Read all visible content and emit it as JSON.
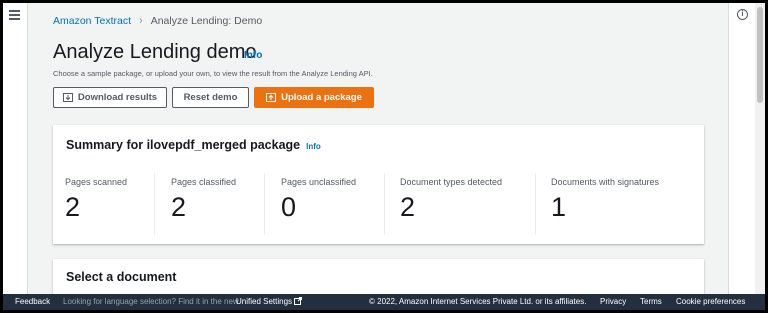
{
  "breadcrumb": {
    "root": "Amazon Textract",
    "current": "Analyze Lending: Demo"
  },
  "page": {
    "title": "Analyze Lending demo",
    "info_label": "Info",
    "description": "Choose a sample package, or upload your own, to view the result from the Analyze Lending API."
  },
  "actions": {
    "download": "Download results",
    "reset": "Reset demo",
    "upload": "Upload a package"
  },
  "summary": {
    "title": "Summary for ilovepdf_merged package",
    "info_label": "Info",
    "metrics": [
      {
        "label": "Pages scanned",
        "value": "2"
      },
      {
        "label": "Pages classified",
        "value": "2"
      },
      {
        "label": "Pages unclassified",
        "value": "0"
      },
      {
        "label": "Document types detected",
        "value": "2"
      },
      {
        "label": "Documents with signatures",
        "value": "1"
      }
    ]
  },
  "select_document": {
    "title": "Select a document"
  },
  "footer": {
    "feedback": "Feedback",
    "language_prompt": "Looking for language selection? Find it in the new",
    "unified_settings": "Unified Settings",
    "copyright": "© 2022, Amazon Internet Services Private Ltd. or its affiliates.",
    "privacy": "Privacy",
    "terms": "Terms",
    "cookies": "Cookie preferences"
  },
  "colors": {
    "accent": "#ec7211",
    "link": "#0073bb",
    "footer_bg": "#232f3e"
  },
  "icons": {
    "nav": "hamburger-icon",
    "help": "info-circle-icon",
    "download": "download-icon",
    "upload": "upload-icon",
    "external": "external-link-icon"
  }
}
